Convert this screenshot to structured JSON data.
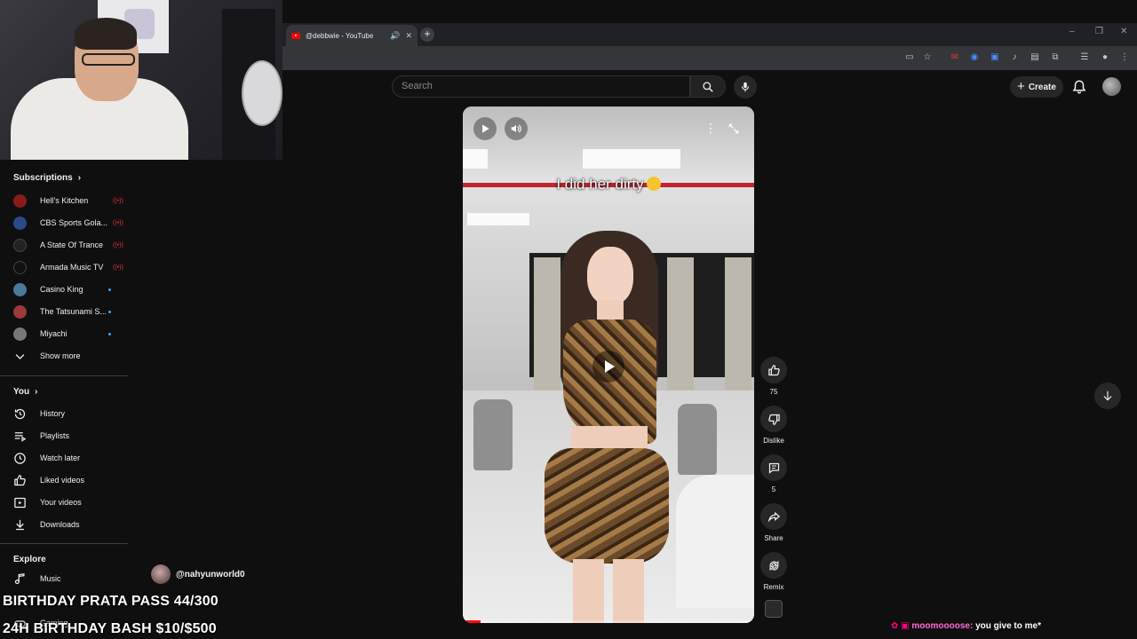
{
  "browser": {
    "tab_title": "@debbwie - YouTube",
    "new_tab": "+",
    "tab_close": "✕",
    "tab_audio": "🔊",
    "window_controls": [
      "–",
      "❐",
      "✕"
    ]
  },
  "header": {
    "search_placeholder": "Search",
    "create_label": "Create"
  },
  "sidebar": {
    "subscriptions_title": "Subscriptions",
    "subscriptions": [
      {
        "label": "Hell's Kitchen",
        "status": "live",
        "color": "#8b1b1b"
      },
      {
        "label": "CBS Sports Gola...",
        "status": "live",
        "color": "#2a4a8a"
      },
      {
        "label": "A State Of Trance",
        "status": "live",
        "color": "#222222"
      },
      {
        "label": "Armada Music TV",
        "status": "live",
        "color": "#111111"
      },
      {
        "label": "Casino King",
        "status": "new",
        "color": "#4a7a9a"
      },
      {
        "label": "The Tatsunami S...",
        "status": "new",
        "color": "#9a3a3a"
      },
      {
        "label": "Miyachi",
        "status": "new",
        "color": "#777777"
      }
    ],
    "show_more": "Show more",
    "you_title": "You",
    "you_items": [
      "History",
      "Playlists",
      "Watch later",
      "Liked videos",
      "Your videos",
      "Downloads"
    ],
    "explore_title": "Explore",
    "explore_items": [
      "Music",
      "Gaming"
    ]
  },
  "short": {
    "caption": "I did her dirty",
    "channel": "@nahyunworld0",
    "progress": 0.06
  },
  "actions": {
    "likes": "75",
    "dislike": "Dislike",
    "comments": "5",
    "share": "Share",
    "remix": "Remix"
  },
  "stream_overlay": {
    "line1": "BIRTHDAY PRATA PASS 44/300",
    "line2": "24H BIRTHDAY BASH $10/$500",
    "chat_user": "moomoooose:",
    "chat_msg": "you give to me*"
  }
}
